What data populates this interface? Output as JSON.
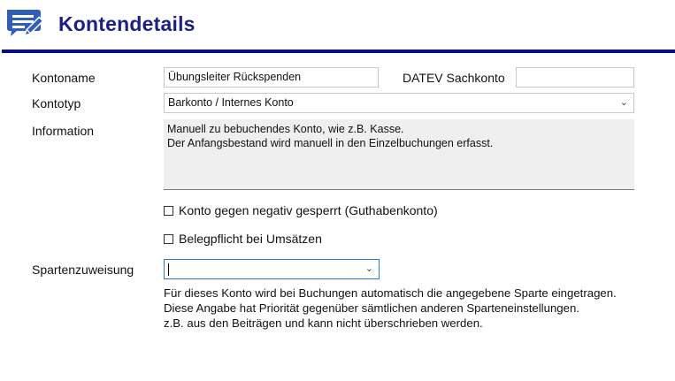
{
  "header": {
    "title": "Kontendetails"
  },
  "form": {
    "kontoname_label": "Kontoname",
    "kontoname_value": "Übungsleiter Rückspenden",
    "datev_label": "DATEV Sachkonto",
    "datev_value": "",
    "kontotyp_label": "Kontotyp",
    "kontotyp_value": "Barkonto / Internes Konto",
    "information_label": "Information",
    "information_lines": [
      "Manuell zu bebuchendes Konto, wie z.B. Kasse.",
      "Der Anfangsbestand wird manuell in den Einzelbuchungen erfasst."
    ],
    "checkbox_negativ_label": "Konto gegen negativ gesperrt (Guthabenkonto)",
    "checkbox_negativ_checked": false,
    "checkbox_beleg_label": "Belegpflicht bei Umsätzen",
    "checkbox_beleg_checked": false,
    "sparte_label": "Spartenzuweisung",
    "sparte_value": "",
    "note_lines": [
      "Für dieses Konto wird bei Buchungen automatisch die angegebene Sparte eingetragen.",
      "Diese Angabe hat Priorität gegenüber sämtlichen anderen Sparteneinstellungen.",
      "z.B. aus den Beiträgen und kann nicht überschrieben werden."
    ]
  },
  "icons": {
    "logo": "notes-pencil-icon",
    "dropdown": "chevron-down-icon"
  },
  "colors": {
    "title": "#1a1f8a",
    "rule": "#0c0c86",
    "logo": "#2f5fb8"
  }
}
